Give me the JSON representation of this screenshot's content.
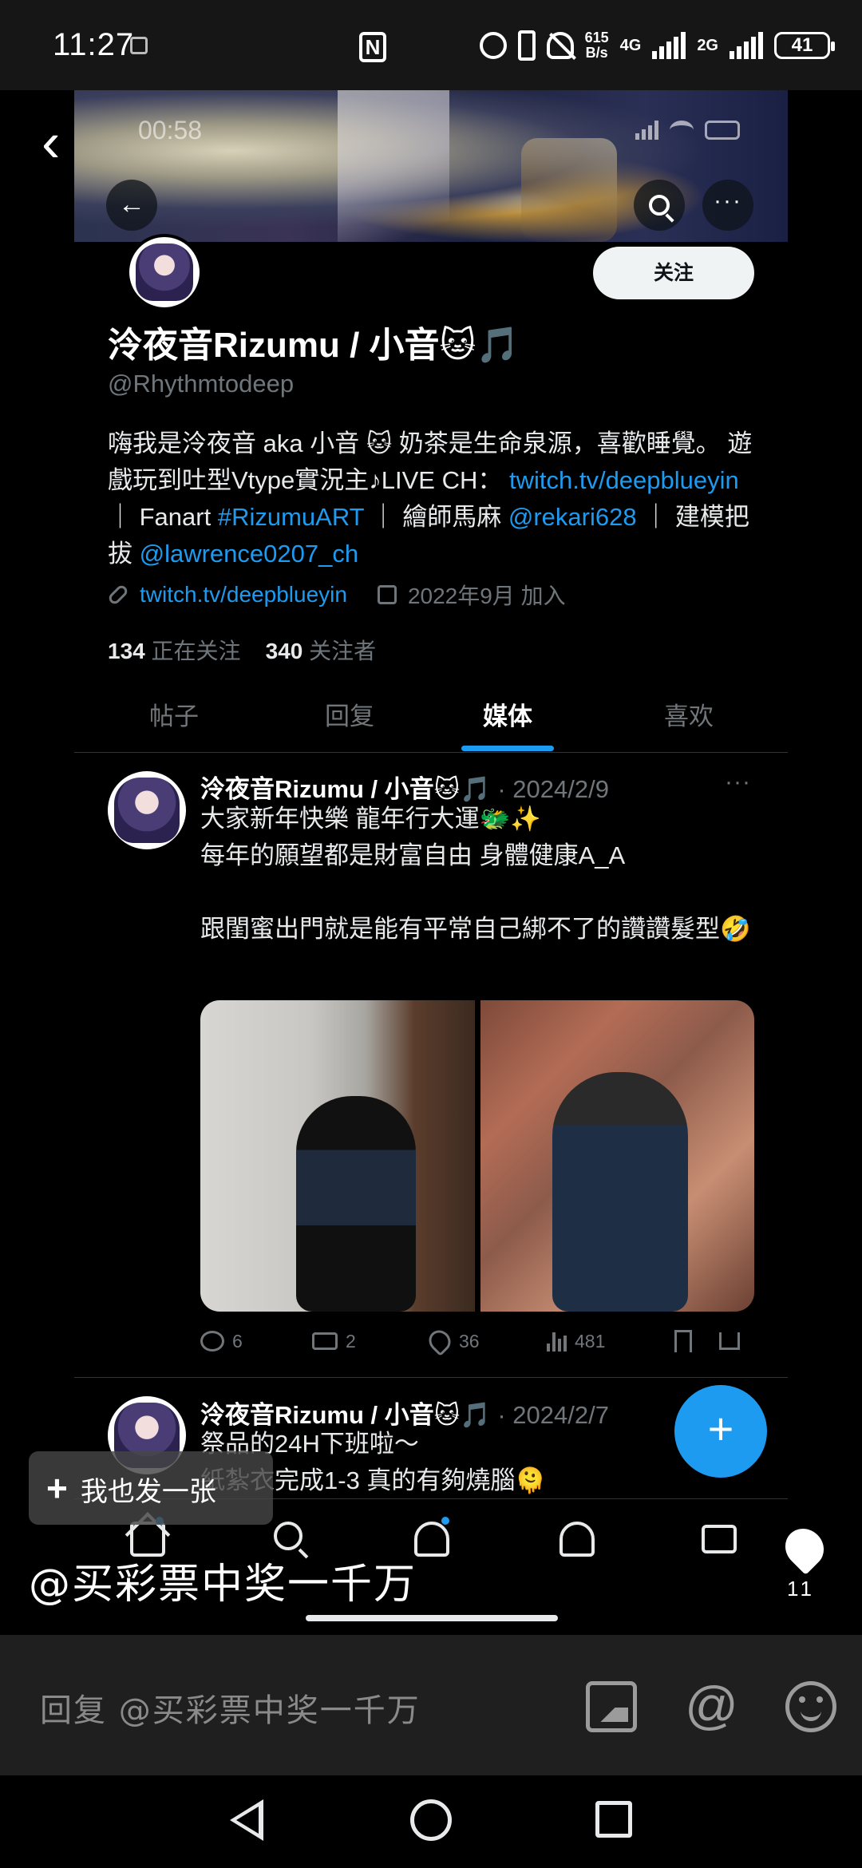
{
  "status_bar": {
    "time": "11:27",
    "net_speed_value": "615",
    "net_speed_unit": "B/s",
    "network_1": "4G",
    "network_2": "2G",
    "battery": "41"
  },
  "inner_status": {
    "time": "00:58"
  },
  "profile": {
    "follow_label": "关注",
    "name": "泠夜音Rizumu / 小音🐱🎵",
    "handle": "@Rhythmtodeep",
    "bio_part1": "嗨我是泠夜音 aka 小音 🐱 奶茶是生命泉源，喜歡睡覺。 遊戲玩到吐型Vtype實況主♪LIVE CH： ",
    "bio_link1": "twitch.tv/deepblueyin",
    "bio_part2": " ｜ Fanart ",
    "bio_hashtag": "#RizumuART",
    "bio_part3": " ｜ 繪師馬麻 ",
    "bio_mention1": "@rekari628",
    "bio_part4": " ｜ 建模把拔 ",
    "bio_mention2": "@lawrence0207_ch",
    "website": "twitch.tv/deepblueyin",
    "joined": "2022年9月 加入",
    "following_count": "134",
    "following_label": "正在关注",
    "followers_count": "340",
    "followers_label": "关注者"
  },
  "tabs": [
    {
      "label": "帖子"
    },
    {
      "label": "回复"
    },
    {
      "label": "媒体"
    },
    {
      "label": "喜欢"
    }
  ],
  "tweets": [
    {
      "name": "泠夜音Rizumu / 小音🐱🎵",
      "date": "· 2024/2/9",
      "text": "大家新年快樂 龍年行大運🐲✨\n每年的願望都是財富自由 身體健康A_A\n\n跟閨蜜出門就是能有平常自己綁不了的讚讚髮型🤣",
      "replies": "6",
      "retweets": "2",
      "likes": "36",
      "views": "481"
    },
    {
      "name": "泠夜音Rizumu / 小音🐱🎵",
      "date": "· 2024/2/7",
      "text": "祭品的24H下班啦～\n紙紮衣完成1-3 真的有夠燒腦🫠"
    }
  ],
  "overlay": {
    "join_label": "我也发一张",
    "watermark": "@买彩票中奖一千万",
    "heart_count": "11"
  },
  "reply_bar": {
    "placeholder": "回复 @买彩票中奖一千万"
  }
}
